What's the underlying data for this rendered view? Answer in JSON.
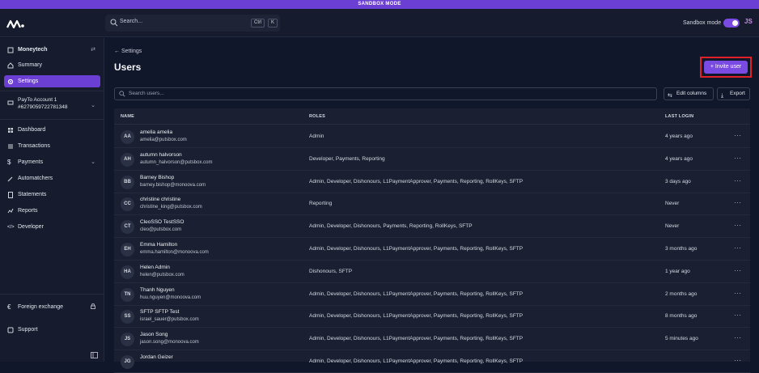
{
  "banner": "SANDBOX MODE",
  "topbar": {
    "search_placeholder": "Search...",
    "shortcut_key1": "Ctrl",
    "shortcut_key2": "K",
    "sandbox_label": "Sandbox mode",
    "sandbox_on": true,
    "user_initials": "JS"
  },
  "sidebar": {
    "org": "Moneytech",
    "summary": "Summary",
    "settings": "Settings",
    "account_name": "PayTo Account 1",
    "account_number": "#6279059722781348",
    "dashboard": "Dashboard",
    "transactions": "Transactions",
    "payments": "Payments",
    "automatchers": "Automatchers",
    "statements": "Statements",
    "reports": "Reports",
    "developer": "Developer",
    "foreign_exchange": "Foreign exchange",
    "support": "Support"
  },
  "main": {
    "breadcrumb": "Settings",
    "title": "Users",
    "invite_label": "Invite user",
    "search_placeholder": "Search users...",
    "edit_columns": "Edit columns",
    "export": "Export"
  },
  "table": {
    "headers": {
      "name": "NAME",
      "roles": "ROLES",
      "last_login": "LAST LOGIN"
    },
    "rows": [
      {
        "initials": "AA",
        "name": "amelia amelia",
        "email": "amelia@putsbox.com",
        "roles": "Admin",
        "last_login": "4 years ago"
      },
      {
        "initials": "AH",
        "name": "autumn halvorson",
        "email": "autumn_halvorson@putsbox.com",
        "roles": "Developer, Payments, Reporting",
        "last_login": "4 years ago"
      },
      {
        "initials": "BB",
        "name": "Barney Bishop",
        "email": "barney.bishop@monoova.com",
        "roles": "Admin, Developer, Dishonours, L1PaymentApprover, Payments, Reporting, RollKeys, SFTP",
        "last_login": "3 days ago"
      },
      {
        "initials": "CC",
        "name": "christine christine",
        "email": "christine_king@putsbox.com",
        "roles": "Reporting",
        "last_login": "Never"
      },
      {
        "initials": "CT",
        "name": "CleoSSO TestSSO",
        "email": "cleo@putsbox.com",
        "roles": "Admin, Developer, Dishonours, Payments, Reporting, RollKeys, SFTP",
        "last_login": "Never"
      },
      {
        "initials": "EH",
        "name": "Emma Hamilton",
        "email": "emma.hamilton@monoova.com",
        "roles": "Admin, Developer, Dishonours, L1PaymentApprover, Payments, Reporting, RollKeys, SFTP",
        "last_login": "3 months ago"
      },
      {
        "initials": "HA",
        "name": "Helen Admin",
        "email": "helen@putsbox.com",
        "roles": "Dishonours, SFTP",
        "last_login": "1 year ago"
      },
      {
        "initials": "TN",
        "name": "Thanh Nguyen",
        "email": "huu.nguyen@monoova.com",
        "roles": "Admin, Developer, Dishonours, L1PaymentApprover, Payments, Reporting, RollKeys, SFTP",
        "last_login": "2 months ago"
      },
      {
        "initials": "SS",
        "name": "SFTP SFTP Test",
        "email": "israel_sauer@putsbox.com",
        "roles": "Admin, Developer, Dishonours, L1PaymentApprover, Payments, Reporting, RollKeys, SFTP",
        "last_login": "8 months ago"
      },
      {
        "initials": "JS",
        "name": "Jason Song",
        "email": "jason.song@monoova.com",
        "roles": "Admin, Developer, Dishonours, L1PaymentApprover, Payments, Reporting, RollKeys, SFTP",
        "last_login": "5 minutes ago"
      },
      {
        "initials": "JG",
        "name": "Jordan Geizer",
        "email": "",
        "roles": "Admin, Developer, Dishonours, L1PaymentApprover, Payments, Reporting, RollKeys, SFTP",
        "last_login": ""
      }
    ]
  },
  "colors": {
    "accent": "#6b3fd4",
    "highlight": "#e0212a",
    "background": "#11172a"
  }
}
